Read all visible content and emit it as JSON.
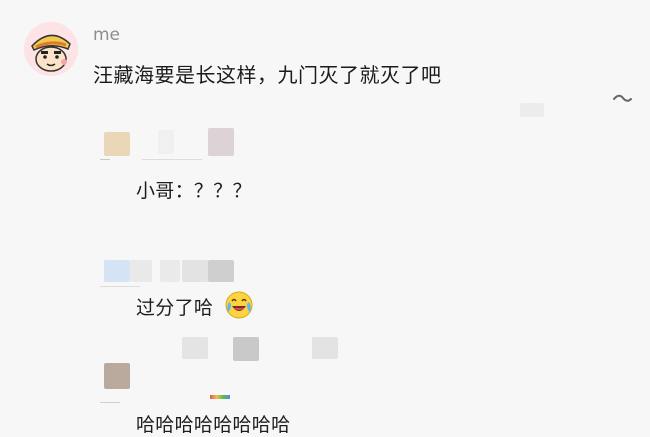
{
  "post": {
    "author": "me",
    "text": "汪藏海要是长这样，九门灭了就灭了吧",
    "avatar_icon": "crayon-shin-chan-avatar"
  },
  "replies": [
    {
      "text": "小哥：？？？",
      "emoji": ""
    },
    {
      "text": "过分了哈",
      "emoji": "crying-laughing-emoji"
    },
    {
      "text": "哈哈哈哈哈哈哈哈",
      "emoji": ""
    }
  ],
  "colors": {
    "background": "#f7f7f7",
    "author": "#8d8d8d",
    "text": "#1b1b1b"
  }
}
